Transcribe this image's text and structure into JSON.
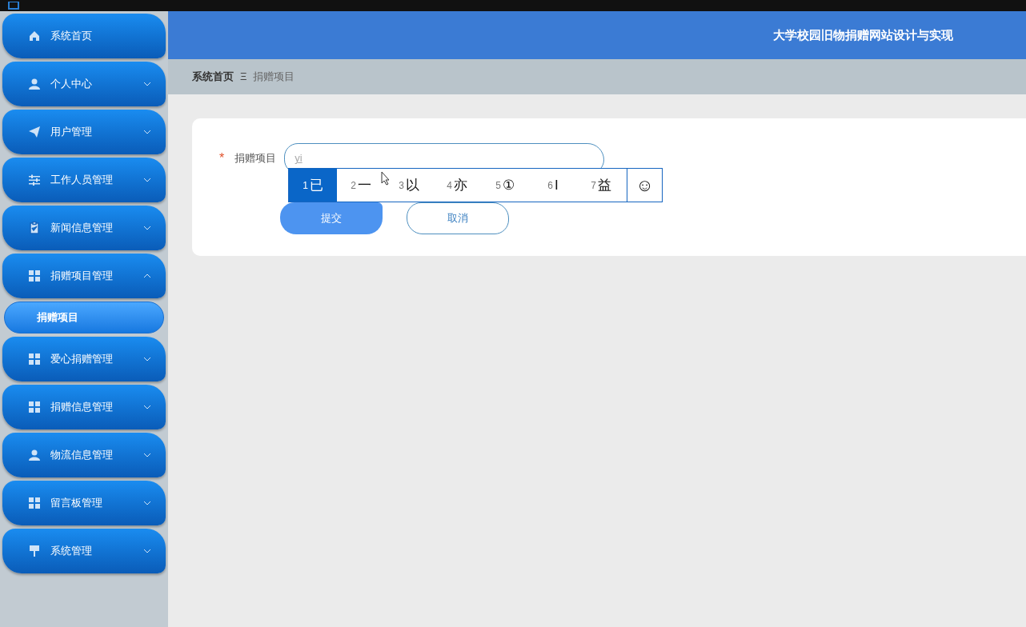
{
  "header": {
    "title": "大学校园旧物捐赠网站设计与实现"
  },
  "sidebar": {
    "items": [
      {
        "label": "系统首页",
        "kind": "link"
      },
      {
        "label": "个人中心",
        "kind": "menu",
        "expanded": false
      },
      {
        "label": "用户管理",
        "kind": "menu",
        "expanded": false
      },
      {
        "label": "工作人员管理",
        "kind": "menu",
        "expanded": false
      },
      {
        "label": "新闻信息管理",
        "kind": "menu",
        "expanded": false
      },
      {
        "label": "捐赠项目管理",
        "kind": "menu",
        "expanded": true,
        "children": [
          {
            "label": "捐赠项目",
            "selected": true
          }
        ]
      },
      {
        "label": "爱心捐赠管理",
        "kind": "menu",
        "expanded": false
      },
      {
        "label": "捐赠信息管理",
        "kind": "menu",
        "expanded": false
      },
      {
        "label": "物流信息管理",
        "kind": "menu",
        "expanded": false
      },
      {
        "label": "留言板管理",
        "kind": "menu",
        "expanded": false
      },
      {
        "label": "系统管理",
        "kind": "menu",
        "expanded": false
      }
    ]
  },
  "breadcrumb": {
    "items": [
      "系统首页",
      "捐赠项目"
    ],
    "separator": "Ξ"
  },
  "form": {
    "field": {
      "label": "捐赠项目",
      "required_mark": "*",
      "value": "yi"
    },
    "buttons": [
      {
        "label": "提交",
        "kind": "primary"
      },
      {
        "label": "取消",
        "kind": "secondary"
      }
    ]
  },
  "ime": {
    "candidates": [
      {
        "number": "1",
        "text": "已",
        "selected": true
      },
      {
        "number": "2",
        "text": "一",
        "selected": false
      },
      {
        "number": "3",
        "text": "以",
        "selected": false
      },
      {
        "number": "4",
        "text": "亦",
        "selected": false
      },
      {
        "number": "5",
        "text": "①",
        "selected": false
      },
      {
        "number": "6",
        "text": "I",
        "selected": false
      },
      {
        "number": "7",
        "text": "益",
        "selected": false
      }
    ],
    "emoji": "☺"
  }
}
